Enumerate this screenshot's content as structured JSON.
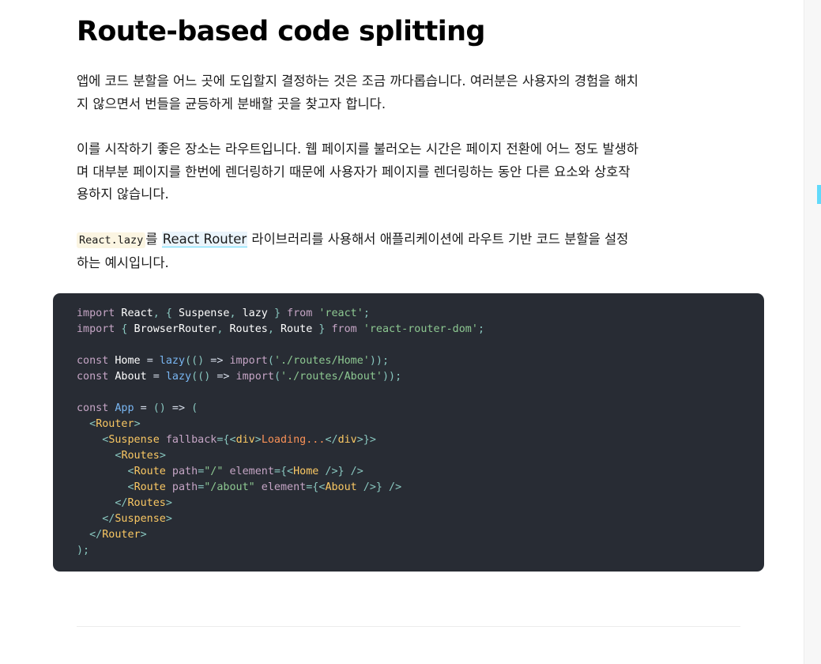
{
  "heading": "Route-based code splitting",
  "paragraphs": {
    "p1": "앱에 코드 분할을 어느 곳에 도입할지 결정하는 것은 조금 까다롭습니다. 여러분은 사용자의 경험을 해치지 않으면서 번들을 균등하게 분배할 곳을 찾고자 합니다.",
    "p2": "이를 시작하기 좋은 장소는 라우트입니다. 웹 페이지를 불러오는 시간은 페이지 전환에 어느 정도 발생하며 대부분 페이지를 한번에 렌더링하기 때문에 사용자가 페이지를 렌더링하는 동안 다른 요소와 상호작용하지 않습니다.",
    "p3": {
      "code": "React.lazy",
      "before_link": "를 ",
      "link": "React Router",
      "after_link": " 라이브러리를 사용해서 애플리케이션에 라우트 기반 코드 분할을 설정하는 예시입니다."
    }
  },
  "code": {
    "lines": [
      [
        [
          "kw",
          "import"
        ],
        [
          "plain",
          " React"
        ],
        [
          "punc",
          ", {"
        ],
        [
          "plain",
          " Suspense"
        ],
        [
          "punc",
          ","
        ],
        [
          "plain",
          " lazy "
        ],
        [
          "punc",
          "}"
        ],
        [
          "kw",
          " from "
        ],
        [
          "str",
          "'react'"
        ],
        [
          "punc",
          ";"
        ]
      ],
      [
        [
          "kw",
          "import"
        ],
        [
          "punc",
          " {"
        ],
        [
          "plain",
          " BrowserRouter"
        ],
        [
          "punc",
          ","
        ],
        [
          "plain",
          " Routes"
        ],
        [
          "punc",
          ","
        ],
        [
          "plain",
          " Route "
        ],
        [
          "punc",
          "}"
        ],
        [
          "kw",
          " from "
        ],
        [
          "str",
          "'react-router-dom'"
        ],
        [
          "punc",
          ";"
        ]
      ],
      [],
      [
        [
          "kw",
          "const"
        ],
        [
          "plain",
          " Home "
        ],
        [
          "op",
          "="
        ],
        [
          "fn",
          " lazy"
        ],
        [
          "punc",
          "(()"
        ],
        [
          "op",
          " =>"
        ],
        [
          "kw",
          " import"
        ],
        [
          "punc",
          "("
        ],
        [
          "str",
          "'./routes/Home'"
        ],
        [
          "punc",
          "));"
        ]
      ],
      [
        [
          "kw",
          "const"
        ],
        [
          "plain",
          " About "
        ],
        [
          "op",
          "="
        ],
        [
          "fn",
          " lazy"
        ],
        [
          "punc",
          "(()"
        ],
        [
          "op",
          " =>"
        ],
        [
          "kw",
          " import"
        ],
        [
          "punc",
          "("
        ],
        [
          "str",
          "'./routes/About'"
        ],
        [
          "punc",
          "));"
        ]
      ],
      [],
      [
        [
          "kw",
          "const"
        ],
        [
          "fn",
          " App "
        ],
        [
          "op",
          "="
        ],
        [
          "punc",
          " ()"
        ],
        [
          "op",
          " =>"
        ],
        [
          "punc",
          " ("
        ]
      ],
      [
        [
          "plain",
          "  "
        ],
        [
          "punc",
          "<"
        ],
        [
          "tag",
          "Router"
        ],
        [
          "punc",
          ">"
        ]
      ],
      [
        [
          "plain",
          "    "
        ],
        [
          "punc",
          "<"
        ],
        [
          "tag",
          "Suspense"
        ],
        [
          "attr",
          " fallback"
        ],
        [
          "punc",
          "={<"
        ],
        [
          "tag",
          "div"
        ],
        [
          "punc",
          ">"
        ],
        [
          "text",
          "Loading..."
        ],
        [
          "punc",
          "</"
        ],
        [
          "tag",
          "div"
        ],
        [
          "punc",
          ">}>"
        ]
      ],
      [
        [
          "plain",
          "      "
        ],
        [
          "punc",
          "<"
        ],
        [
          "tag",
          "Routes"
        ],
        [
          "punc",
          ">"
        ]
      ],
      [
        [
          "plain",
          "        "
        ],
        [
          "punc",
          "<"
        ],
        [
          "tag",
          "Route"
        ],
        [
          "attr",
          " path"
        ],
        [
          "punc",
          "="
        ],
        [
          "str",
          "\"/\""
        ],
        [
          "attr",
          " element"
        ],
        [
          "punc",
          "={<"
        ],
        [
          "tag",
          "Home"
        ],
        [
          "punc",
          " />}"
        ],
        [
          "punc",
          " />"
        ]
      ],
      [
        [
          "plain",
          "        "
        ],
        [
          "punc",
          "<"
        ],
        [
          "tag",
          "Route"
        ],
        [
          "attr",
          " path"
        ],
        [
          "punc",
          "="
        ],
        [
          "str",
          "\"/about\""
        ],
        [
          "attr",
          " element"
        ],
        [
          "punc",
          "={<"
        ],
        [
          "tag",
          "About"
        ],
        [
          "punc",
          " />}"
        ],
        [
          "punc",
          " />"
        ]
      ],
      [
        [
          "plain",
          "      "
        ],
        [
          "punc",
          "</"
        ],
        [
          "tag",
          "Routes"
        ],
        [
          "punc",
          ">"
        ]
      ],
      [
        [
          "plain",
          "    "
        ],
        [
          "punc",
          "</"
        ],
        [
          "tag",
          "Suspense"
        ],
        [
          "punc",
          ">"
        ]
      ],
      [
        [
          "plain",
          "  "
        ],
        [
          "punc",
          "</"
        ],
        [
          "tag",
          "Router"
        ],
        [
          "punc",
          ">"
        ]
      ],
      [
        [
          "punc",
          ");"
        ]
      ]
    ]
  },
  "colors": {
    "code_background": "#282c34",
    "link_underline": "#61dafb",
    "inline_code_background": "#fbf5e2"
  }
}
